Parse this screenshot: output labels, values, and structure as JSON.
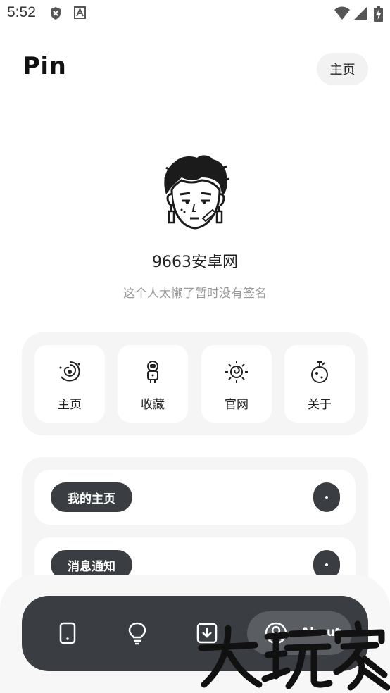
{
  "status_bar": {
    "time": "5:52",
    "left_icons": [
      "shield-icon",
      "a-icon"
    ],
    "right_icons": [
      "wifi-icon",
      "signal-icon",
      "battery-icon"
    ]
  },
  "header": {
    "title": "Pin",
    "home_button": "主页"
  },
  "profile": {
    "name": "9663安卓网",
    "signature": "这个人太懒了暂时没有签名"
  },
  "quick_links": [
    {
      "label": "主页",
      "icon": "galaxy-icon"
    },
    {
      "label": "收藏",
      "icon": "astronaut-icon"
    },
    {
      "label": "官网",
      "icon": "sun-spiral-icon"
    },
    {
      "label": "关于",
      "icon": "planet-icon"
    }
  ],
  "list": [
    {
      "label": "我的主页"
    },
    {
      "label": "消息通知"
    }
  ],
  "bottom_nav": {
    "items": [
      "phone-icon",
      "bulb-icon",
      "download-icon"
    ],
    "active": {
      "icon": "user-icon",
      "label": "About"
    }
  },
  "watermark": {
    "text": "大玩家"
  }
}
